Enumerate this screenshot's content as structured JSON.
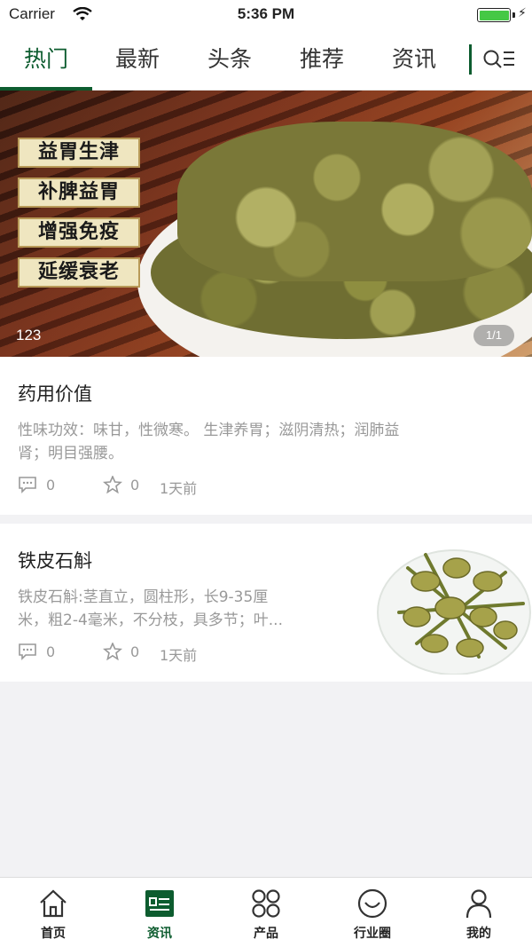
{
  "status_bar": {
    "carrier": "Carrier",
    "time": "5:36 PM"
  },
  "tabs": [
    {
      "label": "热门",
      "active": true
    },
    {
      "label": "最新"
    },
    {
      "label": "头条"
    },
    {
      "label": "推荐"
    },
    {
      "label": "资讯"
    }
  ],
  "banner": {
    "labels": [
      "益胃生津",
      "补脾益胃",
      "增强免疫",
      "延缓衰老"
    ],
    "caption": "123",
    "page_indicator": "1/1"
  },
  "articles": [
    {
      "title": "药用价值",
      "summary_line1": "性味功效：味甘，性微寒。 生津养胃；滋阴清热；润肺益",
      "summary_line2": "肾；明目强腰。",
      "comments": "0",
      "likes": "0",
      "time": "1天前"
    },
    {
      "title": "铁皮石斛",
      "summary_line1": "铁皮石斛:茎直立，圆柱形，长9-35厘",
      "summary_line2": "米，粗2-4毫米，不分枝，具多节；叶...",
      "comments": "0",
      "likes": "0",
      "time": "1天前"
    }
  ],
  "bottom_nav": [
    {
      "label": "首页",
      "icon": "home-icon"
    },
    {
      "label": "资讯",
      "icon": "news-icon",
      "active": true
    },
    {
      "label": "产品",
      "icon": "products-icon"
    },
    {
      "label": "行业圈",
      "icon": "circle-icon"
    },
    {
      "label": "我的",
      "icon": "profile-icon"
    }
  ],
  "colors": {
    "accent": "#0d5c2f",
    "muted_text": "#999999",
    "background": "#f2f2f4"
  }
}
